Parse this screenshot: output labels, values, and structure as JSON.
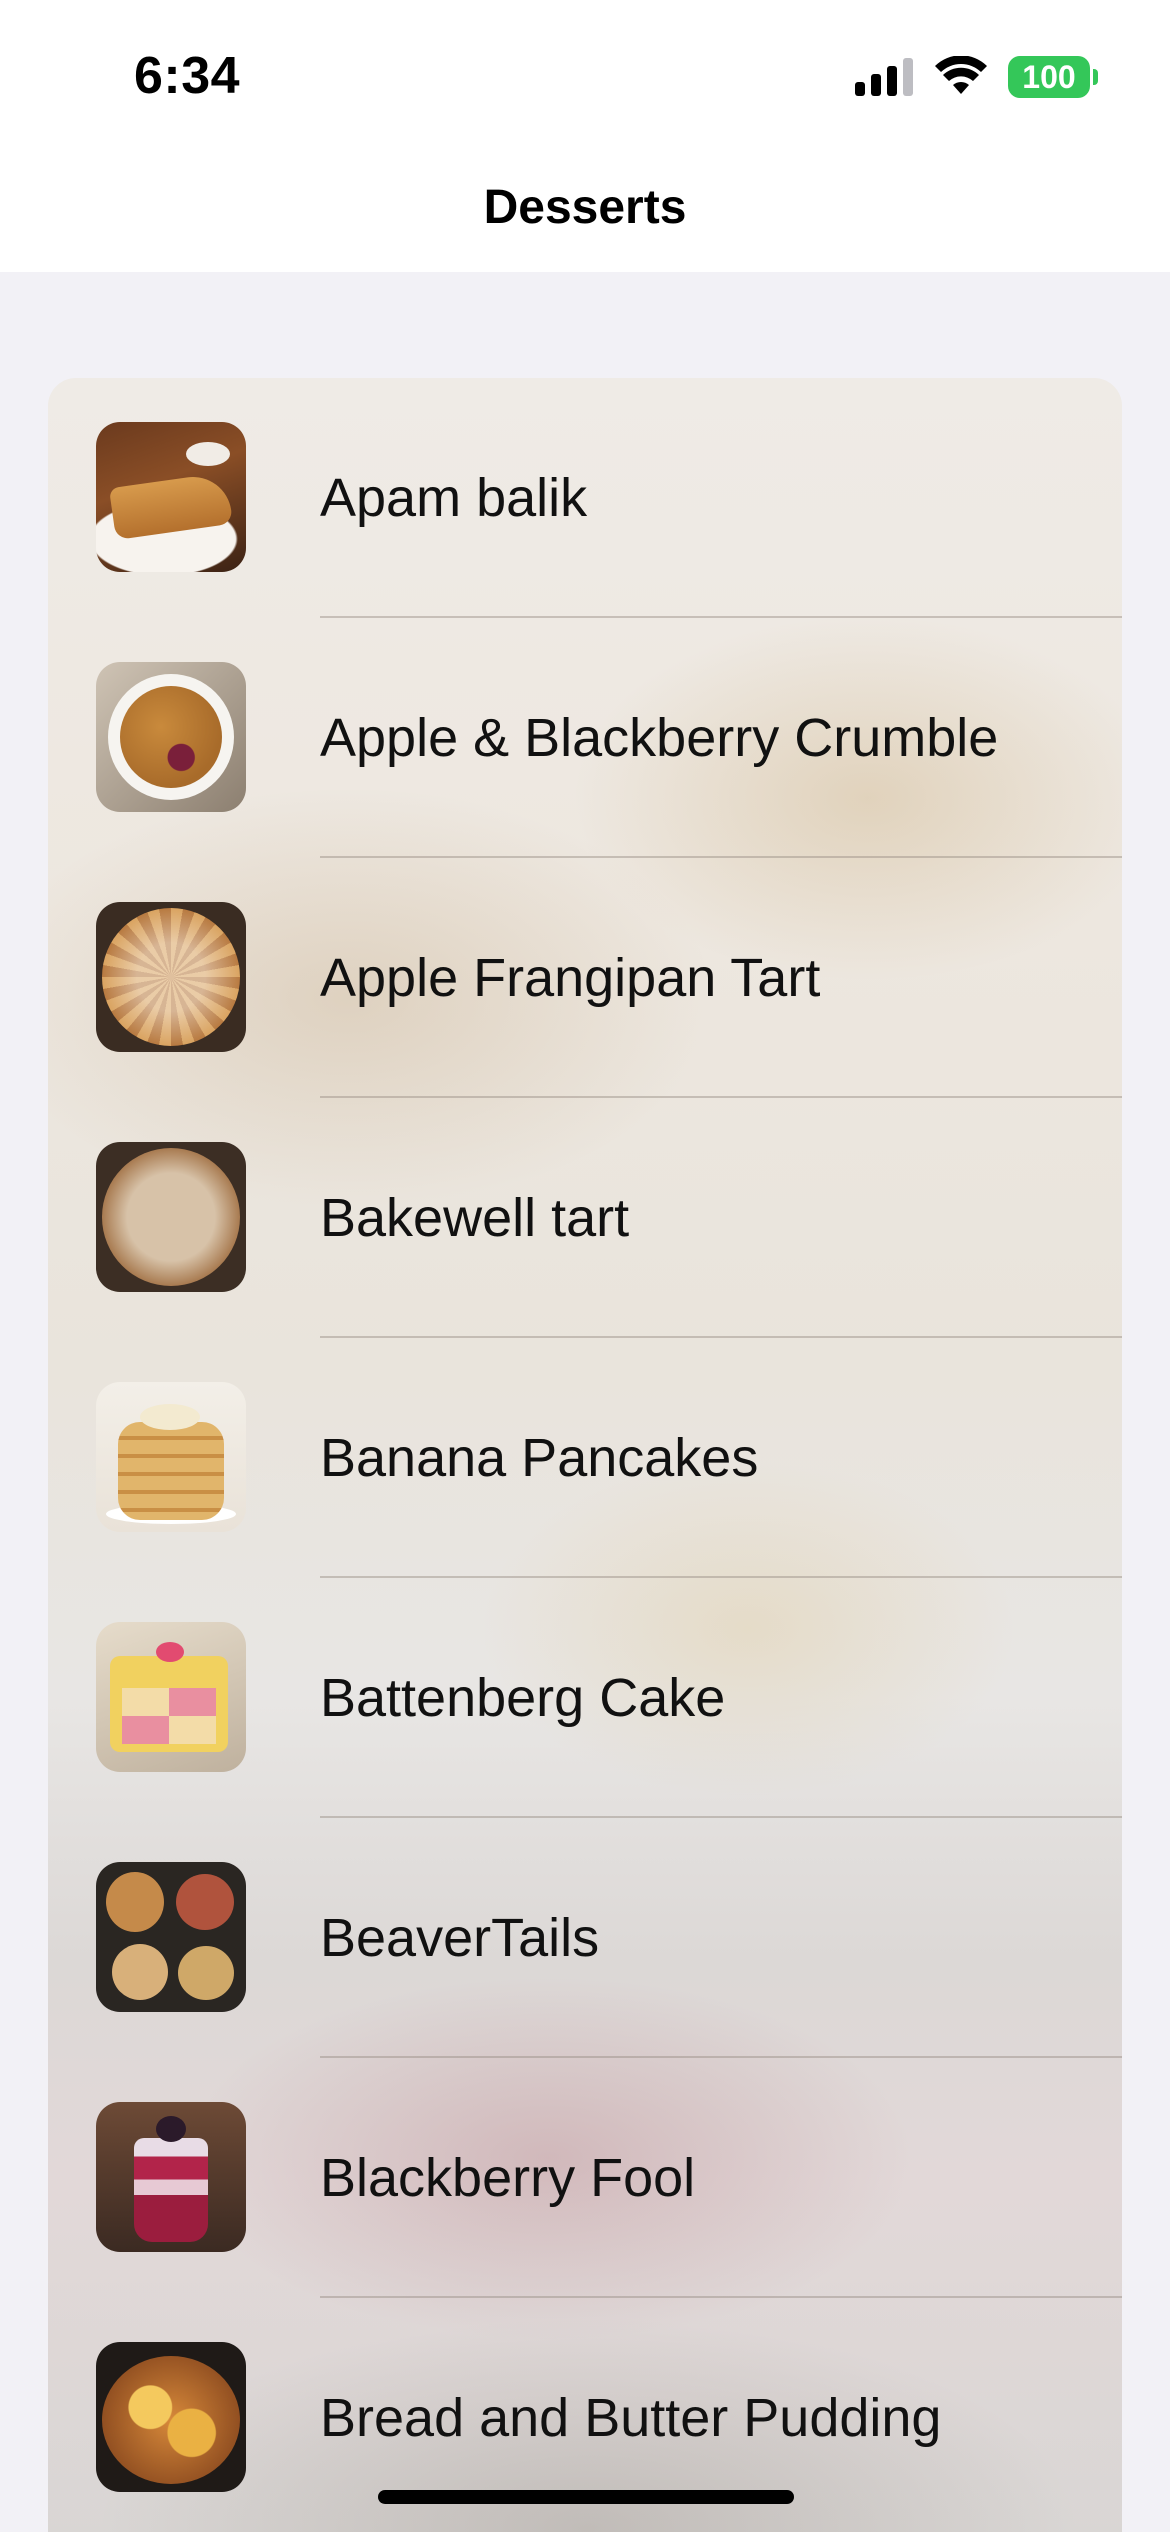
{
  "status_bar": {
    "time": "6:34",
    "battery": "100",
    "icons": [
      "cellular-signal-icon",
      "wifi-icon",
      "battery-icon"
    ],
    "battery_color": "#34c759"
  },
  "nav": {
    "title": "Desserts"
  },
  "desserts": [
    {
      "name": "Apam balik",
      "thumbnail": "apam-balik-photo"
    },
    {
      "name": "Apple & Blackberry Crumble",
      "thumbnail": "apple-blackberry-crumble-photo"
    },
    {
      "name": "Apple Frangipan Tart",
      "thumbnail": "apple-frangipan-tart-photo"
    },
    {
      "name": "Bakewell tart",
      "thumbnail": "bakewell-tart-photo"
    },
    {
      "name": "Banana Pancakes",
      "thumbnail": "banana-pancakes-photo"
    },
    {
      "name": "Battenberg Cake",
      "thumbnail": "battenberg-cake-photo"
    },
    {
      "name": "BeaverTails",
      "thumbnail": "beavertails-photo"
    },
    {
      "name": "Blackberry Fool",
      "thumbnail": "blackberry-fool-photo"
    },
    {
      "name": "Bread and Butter Pudding",
      "thumbnail": "bread-and-butter-pudding-photo"
    }
  ]
}
